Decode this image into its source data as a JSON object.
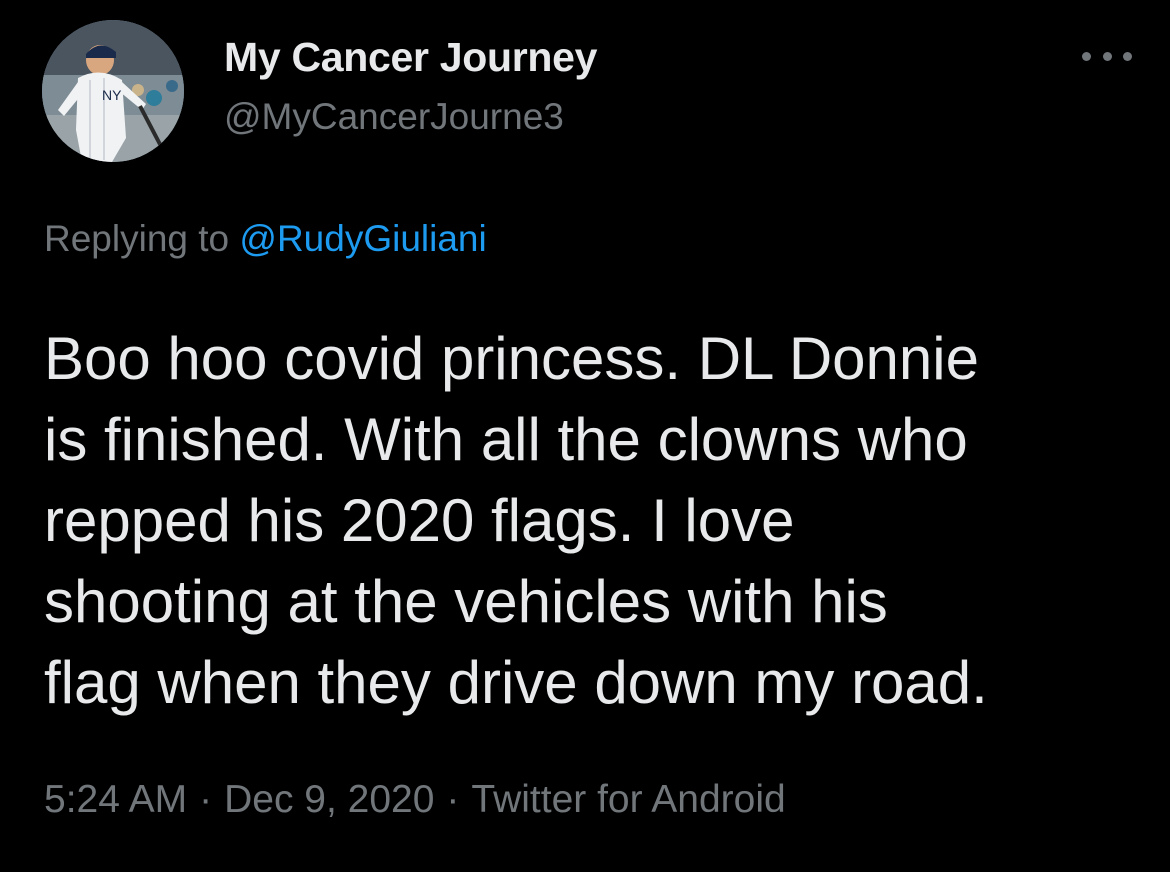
{
  "author": {
    "display_name": "My Cancer Journey",
    "handle": "@MyCancerJourne3",
    "avatar_icon": "baseball-player-avatar"
  },
  "reply_context": {
    "prefix": "Replying to",
    "mention": "@RudyGiuliani"
  },
  "tweet": {
    "lines": [
      "Boo hoo covid princess. DL Donnie",
      "is finished. With all the clowns who",
      "repped his 2020 flags. I love",
      "shooting at the vehicles with his",
      "flag when they drive down my road."
    ]
  },
  "meta": {
    "time": "5:24 AM",
    "date": "Dec 9, 2020",
    "source": "Twitter for Android",
    "separator": "·"
  },
  "icons": {
    "more": "more-options-icon"
  },
  "colors": {
    "background": "#000000",
    "primary_text": "#e7e9ea",
    "secondary_text": "#71767b",
    "link": "#1d9bf0"
  }
}
